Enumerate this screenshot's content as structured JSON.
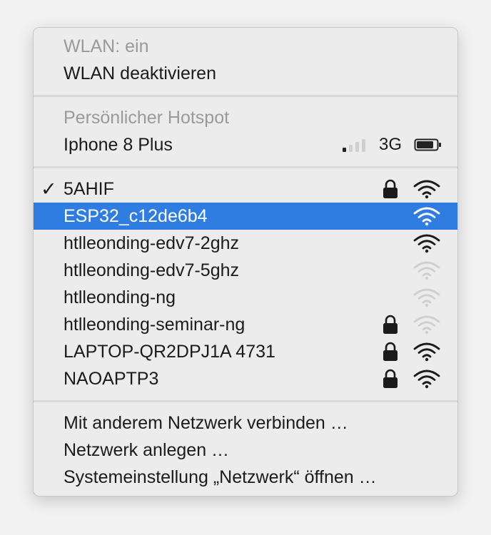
{
  "wlan": {
    "status": "WLAN: ein",
    "toggle": "WLAN deaktivieren"
  },
  "hotspot": {
    "header": "Persönlicher Hotspot",
    "device": "Iphone 8 Plus",
    "signal_bars": 1,
    "network_type": "3G",
    "battery_level": 0.8
  },
  "networks": [
    {
      "name": "5AHIF",
      "connected": true,
      "selected": false,
      "locked": true,
      "signal": 3
    },
    {
      "name": "ESP32_c12de6b4",
      "connected": false,
      "selected": true,
      "locked": false,
      "signal": 3
    },
    {
      "name": "htlleonding-edv7-2ghz",
      "connected": false,
      "selected": false,
      "locked": false,
      "signal": 3
    },
    {
      "name": "htlleonding-edv7-5ghz",
      "connected": false,
      "selected": false,
      "locked": false,
      "signal": 0
    },
    {
      "name": "htlleonding-ng",
      "connected": false,
      "selected": false,
      "locked": false,
      "signal": 0
    },
    {
      "name": "htlleonding-seminar-ng",
      "connected": false,
      "selected": false,
      "locked": true,
      "signal": 0
    },
    {
      "name": "LAPTOP-QR2DPJ1A 4731",
      "connected": false,
      "selected": false,
      "locked": true,
      "signal": 3
    },
    {
      "name": "NAOAPTP3",
      "connected": false,
      "selected": false,
      "locked": true,
      "signal": 3
    }
  ],
  "actions": {
    "other_network": "Mit anderem Netzwerk verbinden …",
    "create_network": "Netzwerk anlegen …",
    "open_prefs": "Systemeinstellung „Netzwerk“ öffnen …"
  },
  "colors": {
    "selection": "#2f7de1",
    "menu_bg": "#ececec",
    "text": "#1b1b1b",
    "disabled_text": "#9a9a9a",
    "faint_icon": "#cfcfcf"
  }
}
